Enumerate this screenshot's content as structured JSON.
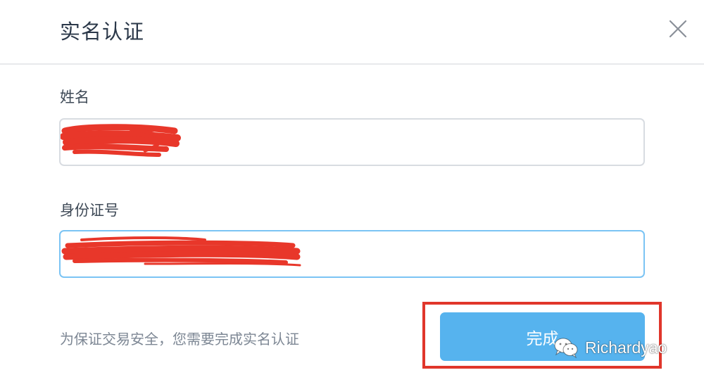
{
  "dialog": {
    "title": "实名认证",
    "close_icon": "close-icon"
  },
  "form": {
    "name_label": "姓名",
    "name_value": "",
    "id_label": "身份证号",
    "id_value": ""
  },
  "footer": {
    "notice": "为保证交易安全，您需要完成实名认证",
    "submit_label": "完成"
  },
  "watermark": {
    "icon": "wechat-icon",
    "text": "Richardyao"
  },
  "colors": {
    "button": "#56b3ee",
    "focus_border": "#7bc4f4",
    "annotation": "#e0362b",
    "redaction": "#e8372a"
  }
}
